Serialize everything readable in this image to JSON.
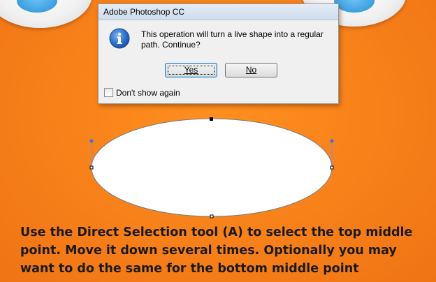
{
  "dialog": {
    "title": "Adobe Photoshop CC",
    "icon": "info-icon",
    "message": "This operation will turn a live shape into a regular path. Continue?",
    "yes_label": "Yes",
    "no_label": "No",
    "checkbox_label": "Don't show again",
    "checkbox_checked": false
  },
  "caption": {
    "line1": "Use the Direct Selection tool (A) to select the top middle",
    "line2": "point. Move it down several times. Optionally you may",
    "line3": "want to do the same for the bottom middle point"
  },
  "colors": {
    "background": "#f7801a",
    "eye_pupil": "#3d9fe0",
    "anchor_handle": "#3b6fd6",
    "caption_text": "#1a1a1a"
  }
}
